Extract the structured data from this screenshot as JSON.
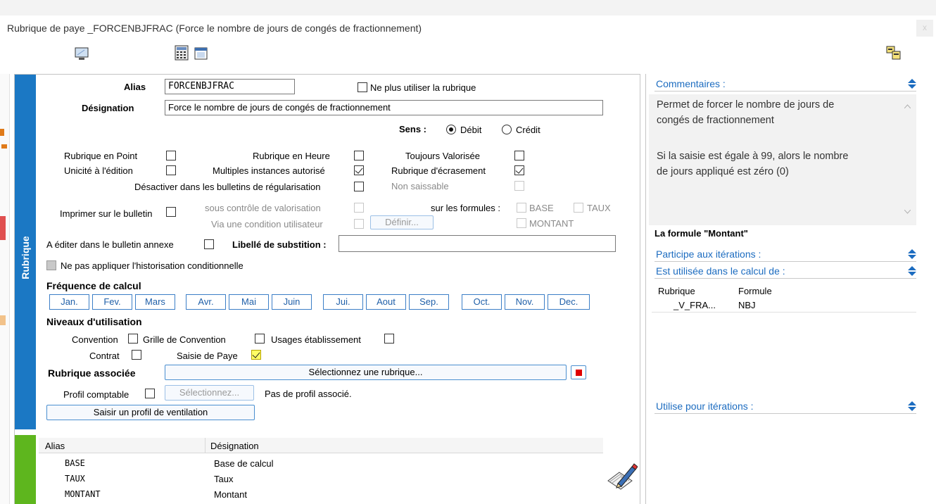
{
  "window": {
    "title": "Rubrique de paye _FORCENBJFRAC (Force le nombre de jours de congés de fractionnement)",
    "close": "x"
  },
  "left_tab": {
    "label": "Rubrique"
  },
  "form": {
    "alias_label": "Alias",
    "alias_value": "FORCENBJFRAC",
    "ne_plus_utiliser": "Ne plus utiliser la rubrique",
    "designation_label": "Désignation",
    "designation_value": "Force le nombre de jours de congés de fractionnement",
    "sens_label": "Sens :",
    "debit": "Débit",
    "credit": "Crédit",
    "rubrique_en_point": "Rubrique en Point",
    "rubrique_en_heure": "Rubrique en Heure",
    "toujours_valorisee": "Toujours Valorisée",
    "unicite": "Unicité à l'édition",
    "multiples": "Multiples instances autorisé",
    "ecrasement": "Rubrique d'écrasement",
    "desactiver": "Désactiver dans les bulletins de régularisation",
    "non_saissable": "Non saissable",
    "imprimer": "Imprimer sur le bulletin",
    "sous_controle": "sous contrôle de valorisation",
    "via_condition": "Via une condition utilisateur",
    "definir": "Définir...",
    "sur_formules": "sur les formules :",
    "base": "BASE",
    "taux": "TAUX",
    "montant": "MONTANT",
    "a_editer": "A éditer dans le bulletin annexe",
    "libelle_substition": "Libellé de substition :",
    "ne_pas_appliquer": "Ne pas appliquer l'historisation conditionnelle",
    "frequence": "Fréquence de calcul",
    "months": [
      "Jan.",
      "Fev.",
      "Mars",
      "Avr.",
      "Mai",
      "Juin",
      "Jui.",
      "Aout",
      "Sep.",
      "Oct.",
      "Nov.",
      "Dec."
    ],
    "niveaux": "Niveaux d'utilisation",
    "convention": "Convention",
    "grille": "Grille de Convention",
    "usages": "Usages établissement",
    "contrat": "Contrat",
    "saisie_paye": "Saisie de Paye",
    "rubrique_associee": "Rubrique associée",
    "selectionnez_rubrique": "Sélectionnez une rubrique...",
    "profil_comptable": "Profil comptable",
    "selectionnez": "Sélectionnez...",
    "pas_de_profil": "Pas de profil associé.",
    "saisir_profil": "Saisir un profil de ventilation"
  },
  "formula_table": {
    "headers": [
      "Alias",
      "Désignation"
    ],
    "rows": [
      {
        "alias": "BASE",
        "designation": "Base de calcul"
      },
      {
        "alias": "TAUX",
        "designation": "Taux"
      },
      {
        "alias": "MONTANT",
        "designation": "Montant"
      }
    ]
  },
  "right_panel": {
    "commentaires_label": "Commentaires :",
    "comment_line1": "Permet de forcer le nombre de jours de",
    "comment_line2": "congés de fractionnement",
    "comment_line3": "Si la saisie est égale à 99, alors le nombre",
    "comment_line4": "de jours appliqué est zéro (0)",
    "formule_title": "La formule \"Montant\"",
    "participe": "Participe aux itérations :",
    "utilisee": "Est utilisée dans le calcul de :",
    "table_headers": [
      "Rubrique",
      "Formule"
    ],
    "table_rows": [
      {
        "rubrique": "_V_FRA...",
        "formule": "NBJ"
      }
    ],
    "utilise_iterations": "Utilise pour itérations :"
  },
  "colors": {
    "blue_tab": "#1b78c4",
    "green_tab": "#5eb61e",
    "link_blue": "#1c6cc0",
    "red_square": "#e00000"
  },
  "icons": [
    "monitor-icon",
    "calculator-icon",
    "window-icon",
    "copy-windows-icon",
    "edit-pen-icon"
  ]
}
